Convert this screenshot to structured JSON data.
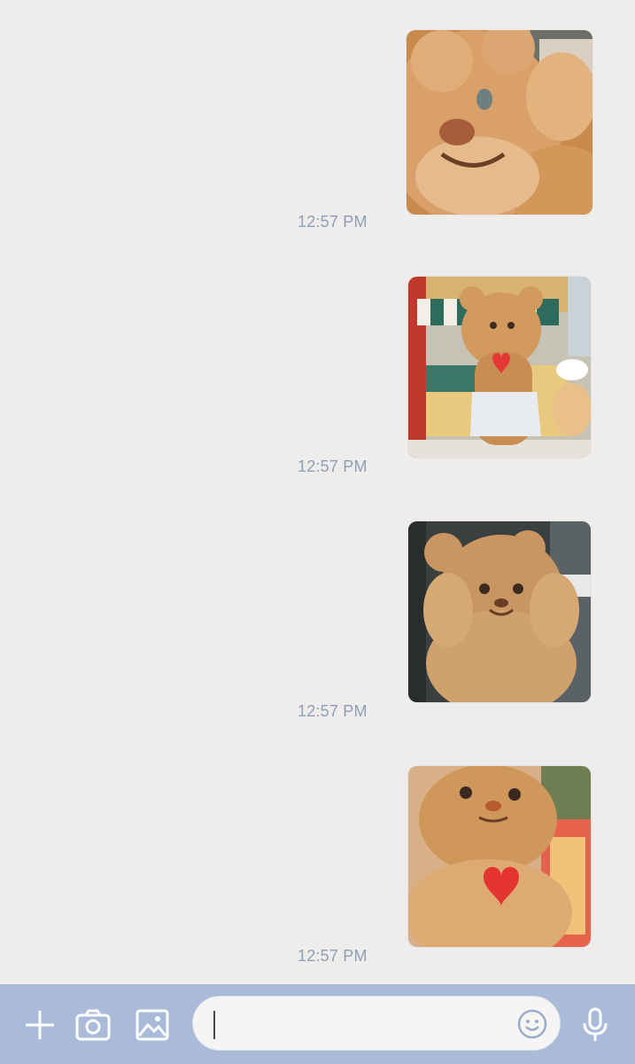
{
  "messages": [
    {
      "time": "12:57 PM",
      "image": "teddy bear mascot waving close-up"
    },
    {
      "time": "12:57 PM",
      "image": "teddy bear mascot with apron holding heart in front of shop"
    },
    {
      "time": "12:57 PM",
      "image": "teddy bear mascot with hands on cheeks"
    },
    {
      "time": "12:57 PM",
      "image": "teddy bear mascot holding red heart"
    }
  ],
  "input_bar": {
    "message_placeholder": "",
    "icons": [
      "plus-icon",
      "camera-icon",
      "gallery-icon",
      "emoji-icon",
      "microphone-icon"
    ]
  },
  "colors": {
    "background": "#efedeb",
    "bar": "#a9bbd9",
    "timestamp": "#8e9fb8"
  }
}
